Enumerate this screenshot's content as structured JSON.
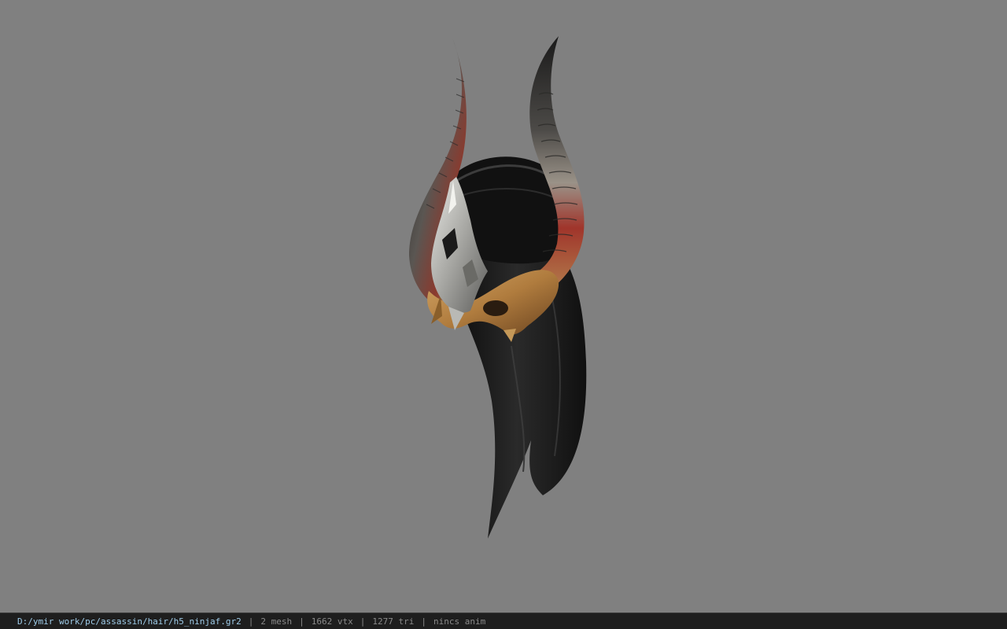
{
  "viewport": {
    "background_color": "#808080",
    "model_name": "horned helmet with long black hair"
  },
  "status_bar": {
    "file_path": "D:/ymir work/pc/assassin/hair/h5_ninjaf.gr2",
    "separator": "|",
    "mesh_count": "2 mesh",
    "vertex_count": "1662 vtx",
    "triangle_count": "1277 tri",
    "anim_status": "nincs anim",
    "path_color": "#9ecbe8",
    "text_color": "#8a8a8a"
  }
}
